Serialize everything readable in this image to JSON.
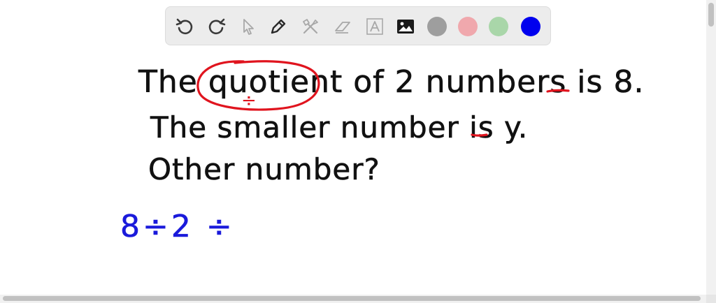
{
  "toolbar": {
    "tools": [
      {
        "name": "undo",
        "icon": "undo-icon"
      },
      {
        "name": "redo",
        "icon": "redo-icon"
      },
      {
        "name": "select",
        "icon": "cursor-icon"
      },
      {
        "name": "pen",
        "icon": "pen-icon"
      },
      {
        "name": "tools",
        "icon": "tools-icon"
      },
      {
        "name": "eraser",
        "icon": "eraser-icon"
      },
      {
        "name": "text",
        "icon": "text-icon"
      },
      {
        "name": "image",
        "icon": "image-icon"
      }
    ],
    "swatches": [
      "#9e9e9e",
      "#f0a8ad",
      "#a9d6a9",
      "#0000ee"
    ]
  },
  "board": {
    "line1_pre": "The",
    "line1_word": "quotient",
    "line1_post": "of 2 numbers is",
    "line1_value": "8",
    "line1_end": ".",
    "line2_pre": "The smaller number is",
    "line2_value": "y",
    "line2_end": ".",
    "line3": "Other number?",
    "math": "8÷2 ÷",
    "divide_symbol": "÷"
  },
  "colors": {
    "ink": "#111111",
    "highlight": "#e0141e",
    "blue_ink": "#1a1adb",
    "toolbar_bg": "#ececec"
  }
}
